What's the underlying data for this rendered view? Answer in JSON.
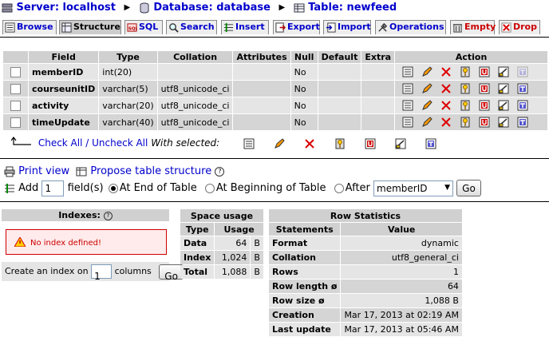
{
  "breadcrumb": {
    "server": "Server: localhost",
    "database": "Database: database",
    "table": "Table: newfeed"
  },
  "tabs": [
    {
      "label": "Browse",
      "icon": "browse-icon"
    },
    {
      "label": "Structure",
      "icon": "structure-icon",
      "active": true
    },
    {
      "label": "SQL",
      "icon": "sql-icon"
    },
    {
      "label": "Search",
      "icon": "search-icon"
    },
    {
      "label": "Insert",
      "icon": "insert-icon"
    },
    {
      "label": "Export",
      "icon": "export-icon"
    },
    {
      "label": "Import",
      "icon": "import-icon"
    },
    {
      "label": "Operations",
      "icon": "operations-icon"
    },
    {
      "label": "Empty",
      "icon": "empty-icon"
    },
    {
      "label": "Drop",
      "icon": "drop-icon"
    }
  ],
  "structure": {
    "headers": [
      "Field",
      "Type",
      "Collation",
      "Attributes",
      "Null",
      "Default",
      "Extra",
      "Action"
    ],
    "rows": [
      {
        "field": "memberID",
        "type": "int(20)",
        "collation": "",
        "attributes": "",
        "null": "No",
        "default": "",
        "extra": ""
      },
      {
        "field": "courseunitID",
        "type": "varchar(5)",
        "collation": "utf8_unicode_ci",
        "attributes": "",
        "null": "No",
        "default": "",
        "extra": ""
      },
      {
        "field": "activity",
        "type": "varchar(20)",
        "collation": "utf8_unicode_ci",
        "attributes": "",
        "null": "No",
        "default": "",
        "extra": ""
      },
      {
        "field": "timeUpdate",
        "type": "varchar(40)",
        "collation": "utf8_unicode_ci",
        "attributes": "",
        "null": "No",
        "default": "",
        "extra": ""
      }
    ]
  },
  "with_selected": {
    "check_all": "Check All",
    "slash": "/",
    "uncheck_all": "Uncheck All",
    "label": "With selected:"
  },
  "tools": {
    "print_view": "Print view",
    "propose": "Propose table structure"
  },
  "add_fields": {
    "add": "Add",
    "count": "1",
    "fields": "field(s)",
    "at_end": "At End of Table",
    "at_beginning": "At Beginning of Table",
    "after": "After",
    "after_field": "memberID",
    "go": "Go"
  },
  "indexes": {
    "title": "Indexes:",
    "no_index": "No index defined!",
    "create_label": "Create an index on",
    "create_count": "1",
    "columns": "columns",
    "go": "Go"
  },
  "space_usage": {
    "title": "Space usage",
    "headers": [
      "Type",
      "Usage"
    ],
    "rows": [
      {
        "type": "Data",
        "value": "64",
        "unit": "B"
      },
      {
        "type": "Index",
        "value": "1,024",
        "unit": "B"
      },
      {
        "type": "Total",
        "value": "1,088",
        "unit": "B"
      }
    ]
  },
  "row_statistics": {
    "title": "Row Statistics",
    "headers": [
      "Statements",
      "Value"
    ],
    "rows": [
      {
        "label": "Format",
        "value": "dynamic"
      },
      {
        "label": "Collation",
        "value": "utf8_general_ci"
      },
      {
        "label": "Rows",
        "value": "1"
      },
      {
        "label": "Row length ø",
        "value": "64"
      },
      {
        "label": "Row size ø",
        "value": "1,088 B"
      },
      {
        "label": "Creation",
        "value": "Mar 17, 2013 at 02:19 AM"
      },
      {
        "label": "Last update",
        "value": "Mar 17, 2013 at 05:46 AM"
      }
    ]
  },
  "colors": {
    "link": "#0000cc",
    "header_bg": "#d0d0d0",
    "row_odd": "#e5e5e5",
    "row_even": "#d5d5d5",
    "error": "#cc0000"
  }
}
